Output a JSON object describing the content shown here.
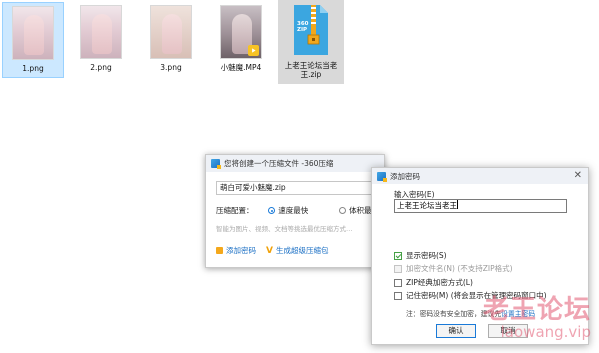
{
  "files": [
    {
      "name": "1.png",
      "selected": true
    },
    {
      "name": "2.png",
      "selected": false
    },
    {
      "name": "3.png",
      "selected": false
    },
    {
      "name": "小魅魔.MP4",
      "selected": false
    },
    {
      "name_line1": "上老王论坛当老",
      "name_line2": "王.zip",
      "icon_text": "360 ZIP",
      "selected": false
    }
  ],
  "compress_dialog": {
    "title": "您将创建一个压缩文件 -360压缩",
    "filename": "萌白可爱小魅魔.zip",
    "config_label": "压缩配置：",
    "option_fast": "速度最快",
    "option_small": "体积最小",
    "hint": "智能为图片、视频、文档等挑选最优压缩方式…",
    "add_password": "添加密码",
    "super_package": "生成超级压缩包"
  },
  "password_dialog": {
    "title": "添加密码",
    "enter_label": "输入密码(E)",
    "password_value": "上老王论坛当老王",
    "show_password": "显示密码(S)",
    "encrypt_filenames": "加密文件名(N) (不支持ZIP格式)",
    "zip_classic": "ZIP经典加密方式(L)",
    "remember": "记住密码(M) (将会显示在管理密码窗口中)",
    "note_prefix": "注：密码没有安全加密，",
    "note_middle": "建议先",
    "note_link": "设置主密码",
    "ok_label": "确认",
    "cancel_label": "取消",
    "show_password_checked": true,
    "encrypt_filenames_checked": false,
    "zip_classic_checked": false,
    "remember_checked": false
  },
  "watermark": {
    "cn": "老王论坛",
    "en": "laowang.vip"
  },
  "colors": {
    "selection": "#cce8ff",
    "accent": "#1a7ad8",
    "watermark": "#e35b74"
  }
}
